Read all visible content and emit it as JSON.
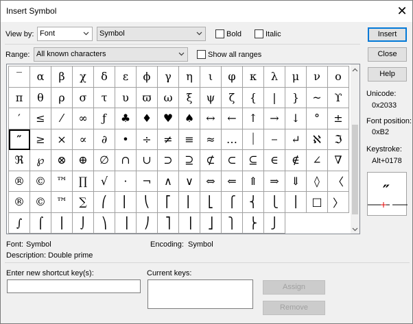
{
  "window": {
    "title": "Insert Symbol",
    "close_glyph": "✕"
  },
  "viewby": {
    "label": "View by:",
    "mode": "Font",
    "font": "Symbol",
    "bold_label": "Bold",
    "italic_label": "Italic"
  },
  "range": {
    "label": "Range:",
    "value": "All known characters",
    "show_all_label": "Show all ranges"
  },
  "grid": {
    "rows": [
      [
        "‾",
        "α",
        "β",
        "χ",
        "δ",
        "ε",
        "ϕ",
        "γ",
        "η",
        "ι",
        "φ",
        "κ",
        "λ",
        "μ",
        "ν",
        "ο"
      ],
      [
        "π",
        "θ",
        "ρ",
        "σ",
        "τ",
        "υ",
        "ϖ",
        "ω",
        "ξ",
        "ψ",
        "ζ",
        "{",
        "|",
        "}",
        "~",
        "ϒ"
      ],
      [
        "′",
        "≤",
        "⁄",
        "∞",
        "ƒ",
        "♣",
        "♦",
        "♥",
        "♠",
        "↔",
        "←",
        "↑",
        "→",
        "↓",
        "°",
        "±"
      ],
      [
        "″",
        "≥",
        "×",
        "∝",
        "∂",
        "•",
        "÷",
        "≠",
        "≡",
        "≈",
        "…",
        "⏐",
        "⎯",
        "↵",
        "ℵ",
        "ℑ"
      ],
      [
        "ℜ",
        "℘",
        "⊗",
        "⊕",
        "∅",
        "∩",
        "∪",
        "⊃",
        "⊇",
        "⊄",
        "⊂",
        "⊆",
        "∈",
        "∉",
        "∠",
        "∇"
      ],
      [
        "®",
        "©",
        "™",
        "∏",
        "√",
        "⋅",
        "¬",
        "∧",
        "∨",
        "⇔",
        "⇐",
        "⇑",
        "⇒",
        "⇓",
        "◊",
        "〈"
      ],
      [
        "®",
        "©",
        "™",
        "∑",
        "⎛",
        "⎜",
        "⎝",
        "⎡",
        "⎢",
        "⎣",
        "⎧",
        "⎨",
        "⎩",
        "⎪",
        "□",
        "〉"
      ],
      [
        "∫",
        "⌠",
        "⎮",
        "⌡",
        "⎞",
        "⎟",
        "⎠",
        "⎤",
        "⎥",
        "⎦",
        "⎫",
        "⎬",
        "⎭",
        "",
        "",
        ""
      ]
    ]
  },
  "buttons": {
    "insert": "Insert",
    "close": "Close",
    "help": "Help",
    "assign": "Assign",
    "remove": "Remove"
  },
  "info": {
    "unicode_label": "Unicode:",
    "unicode_value": "0x2033",
    "fontpos_label": "Font position:",
    "fontpos_value": "0xB2",
    "keystroke_label": "Keystroke:",
    "keystroke_value": "Alt+0178",
    "preview_char": "″"
  },
  "details": {
    "font_label": "Font:",
    "font_value": "Symbol",
    "encoding_label": "Encoding:",
    "encoding_value": "Symbol",
    "description_label": "Description:",
    "description_value": "Double prime"
  },
  "shortcut": {
    "new_label": "Enter new shortcut key(s):",
    "current_label": "Current keys:"
  }
}
